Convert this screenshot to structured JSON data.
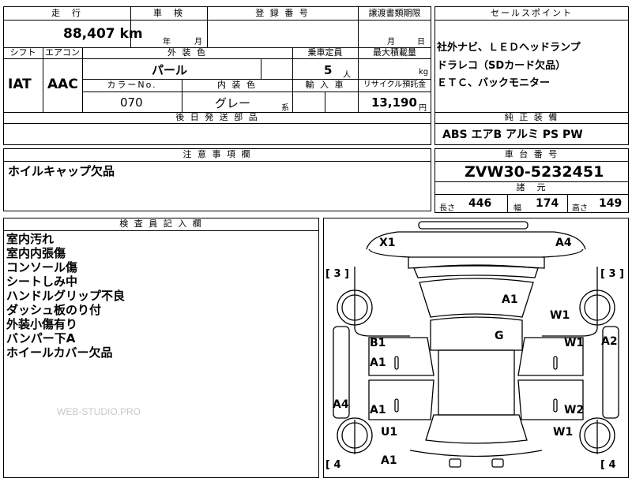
{
  "top_fragment": "",
  "vehicle": {
    "mileage_header": "走　行",
    "mileage_value": "88,407 km",
    "inspection_header": "車　検",
    "inspection_year": "年",
    "inspection_month": "月",
    "registration_header": "登 録 番 号",
    "registration_value": "",
    "transfer_deadline_header": "譲渡書類期限",
    "transfer_month": "月",
    "transfer_day": "日",
    "shift_header": "シフト",
    "shift_value": "IAT",
    "ac_header": "エアコン",
    "ac_value": "AAC",
    "exterior_color_header": "外 装 色",
    "exterior_color_value": "パール",
    "capacity_header": "乗車定員",
    "capacity_value": "5",
    "capacity_unit": "人",
    "max_load_header": "最大積載量",
    "max_load_unit": "kg",
    "color_no_header": "カラーNo.",
    "color_no_value": "070",
    "interior_color_header": "内 装 色",
    "interior_color_value": "グレー",
    "interior_color_suffix": "系",
    "import_header": "輸 入 車",
    "recycle_header": "リサイクル預託金",
    "recycle_value": "13,190",
    "recycle_unit": "円",
    "later_parts_header": "後 日 発 送 部 品"
  },
  "sales_points": {
    "header": "セールスポイント",
    "lines": [
      "社外ナビ、ＬＥＤヘッドランプ",
      "ドラレコ（SDカード欠品）",
      "ＥＴＣ、バックモニター"
    ]
  },
  "standard_equipment": {
    "header": "純 正 装 備",
    "items": "ABS エアB アルミ PS PW"
  },
  "caution": {
    "header": "注 意 事 項 欄",
    "text": "ホイルキャップ欠品"
  },
  "chassis": {
    "header": "車 台 番 号",
    "value": "ZVW30-5232451",
    "specs_header": "諸　元",
    "length_label": "長さ",
    "length_value": "446",
    "width_label": "幅",
    "width_value": "174",
    "height_label": "高さ",
    "height_value": "149"
  },
  "inspector": {
    "header": "検 査 員 記 入 欄",
    "lines": [
      "室内汚れ",
      "室内内張傷",
      "コンソール傷",
      "シートしみ中",
      "ハンドルグリップ不良",
      "ダッシュ板のり付",
      "外装小傷有り",
      "バンパー下A",
      "ホイールカバー欠品"
    ],
    "watermark": "WEB-STUDIO.PRO"
  },
  "diagram": {
    "tire_front_left": "[ 3 ]",
    "tire_front_right": "[ 3 ]",
    "tire_rear_left": "[ 4",
    "tire_rear_right": "[ 4",
    "codes": {
      "x1": "X1",
      "a4_top": "A4",
      "a1_hood": "A1",
      "w1_fr": "W1",
      "g_roof": "G",
      "b1": "B1",
      "a1_fl_door": "A1",
      "w1_r": "W1",
      "a2_right": "A2",
      "a4_left": "A4",
      "a1_rl_door": "A1",
      "w2": "W2",
      "u1": "U1",
      "w1_rr": "W1",
      "a1_rear": "A1"
    }
  }
}
